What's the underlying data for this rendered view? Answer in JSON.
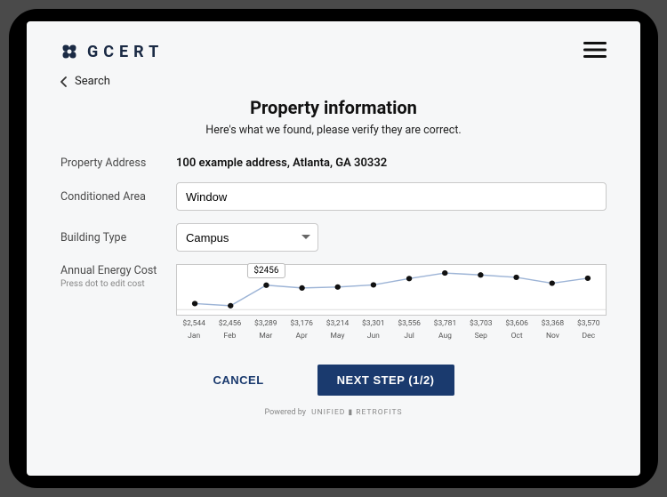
{
  "brand": "GCERT",
  "back_label": "Search",
  "page_title": "Property information",
  "page_subtitle": "Here's what we found, please verify they are correct.",
  "labels": {
    "address": "Property Address",
    "area": "Conditioned Area",
    "building": "Building Type",
    "energy": "Annual Energy Cost",
    "energy_hint": "Press dot to edit cost"
  },
  "values": {
    "address": "100 example address, Atlanta, GA 30332",
    "area": "Window",
    "building": "Campus"
  },
  "chart_data": {
    "type": "line",
    "categories": [
      "Jan",
      "Feb",
      "Mar",
      "Apr",
      "May",
      "Jun",
      "Jul",
      "Aug",
      "Sep",
      "Oct",
      "Nov",
      "Dec"
    ],
    "values": [
      2544,
      2456,
      3289,
      3176,
      3214,
      3301,
      3556,
      3781,
      3703,
      3606,
      3368,
      3570
    ],
    "value_labels": [
      "$2,544",
      "$2,456",
      "$3,289",
      "$3,176",
      "$3,214",
      "$3,301",
      "$3,556",
      "$3,781",
      "$3,703",
      "$3,606",
      "$3,368",
      "$3,570"
    ],
    "ylim": [
      2300,
      3900
    ],
    "tooltip_index": 2,
    "tooltip_text": "$2456"
  },
  "actions": {
    "cancel": "CANCEL",
    "next": "NEXT STEP (1/2)"
  },
  "footer": {
    "powered": "Powered by",
    "brand": "UNIFIED ▮ RETROFITS"
  }
}
